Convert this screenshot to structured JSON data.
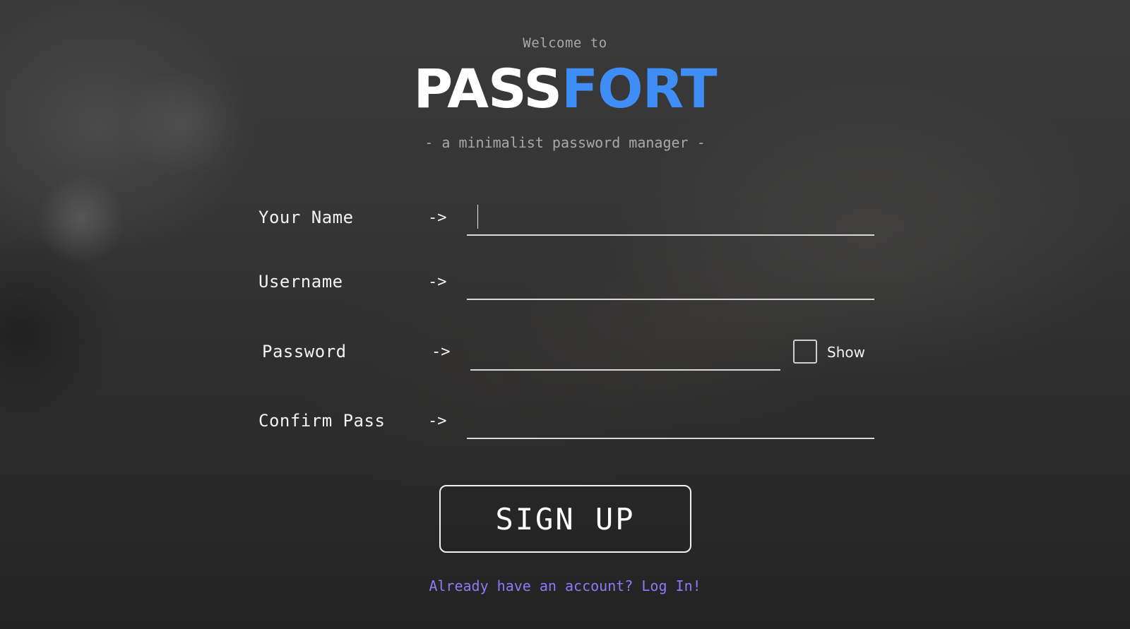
{
  "header": {
    "welcome": "Welcome to",
    "logo_part1": "PASS",
    "logo_part2": "FORT",
    "tagline": "- a minimalist password manager -"
  },
  "form": {
    "fields": [
      {
        "label": "Your Name",
        "arrow": "->",
        "value": ""
      },
      {
        "label": "Username",
        "arrow": "->",
        "value": ""
      },
      {
        "label": "Password",
        "arrow": "->",
        "value": ""
      },
      {
        "label": "Confirm Pass",
        "arrow": "->",
        "value": ""
      }
    ],
    "show_label": "Show",
    "submit_label": "SIGN UP",
    "login_link": "Already have an account? Log In!"
  },
  "colors": {
    "accent": "#3f8ef7",
    "link": "#8b7cf6",
    "text": "#ffffff",
    "muted": "#a9a9a9"
  }
}
